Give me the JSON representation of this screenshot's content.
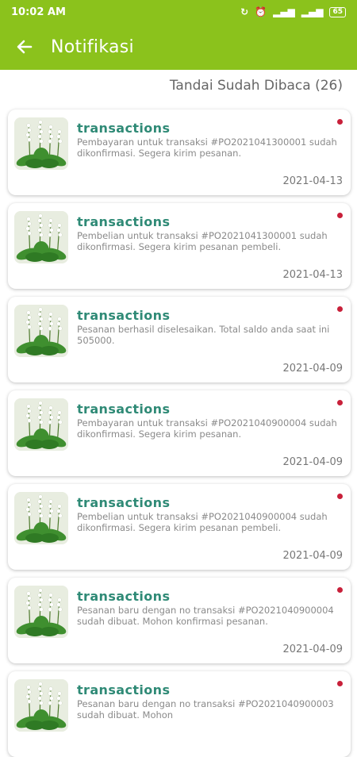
{
  "status_bar": {
    "time": "10:02 AM",
    "battery": "65"
  },
  "app_bar": {
    "title": "Notifikasi"
  },
  "mark_all_read": "Tandai Sudah Dibaca (26)",
  "colors": {
    "brand": "#8bc21c",
    "title": "#2f8a76",
    "unread_dot": "#c8203a"
  },
  "notifications": [
    {
      "title": "transactions",
      "body": "Pembayaran untuk transaksi #PO2021041300001 sudah dikonfirmasi. Segera kirim pesanan.",
      "date": "2021-04-13"
    },
    {
      "title": "transactions",
      "body": "Pembelian untuk transaksi #PO2021041300001 sudah dikonfirmasi. Segera kirim pesanan pembeli.",
      "date": "2021-04-13"
    },
    {
      "title": "transactions",
      "body": "Pesanan berhasil diselesaikan. Total saldo anda saat ini 505000.",
      "date": "2021-04-09"
    },
    {
      "title": "transactions",
      "body": "Pembayaran untuk transaksi #PO2021040900004 sudah dikonfirmasi. Segera kirim pesanan.",
      "date": "2021-04-09"
    },
    {
      "title": "transactions",
      "body": "Pembelian untuk transaksi #PO2021040900004 sudah dikonfirmasi. Segera kirim pesanan pembeli.",
      "date": "2021-04-09"
    },
    {
      "title": "transactions",
      "body": "Pesanan baru dengan no transaksi #PO2021040900004 sudah dibuat. Mohon konfirmasi pesanan.",
      "date": "2021-04-09"
    },
    {
      "title": "transactions",
      "body": "Pesanan baru dengan no transaksi #PO2021040900003 sudah dibuat. Mohon",
      "date": ""
    }
  ]
}
